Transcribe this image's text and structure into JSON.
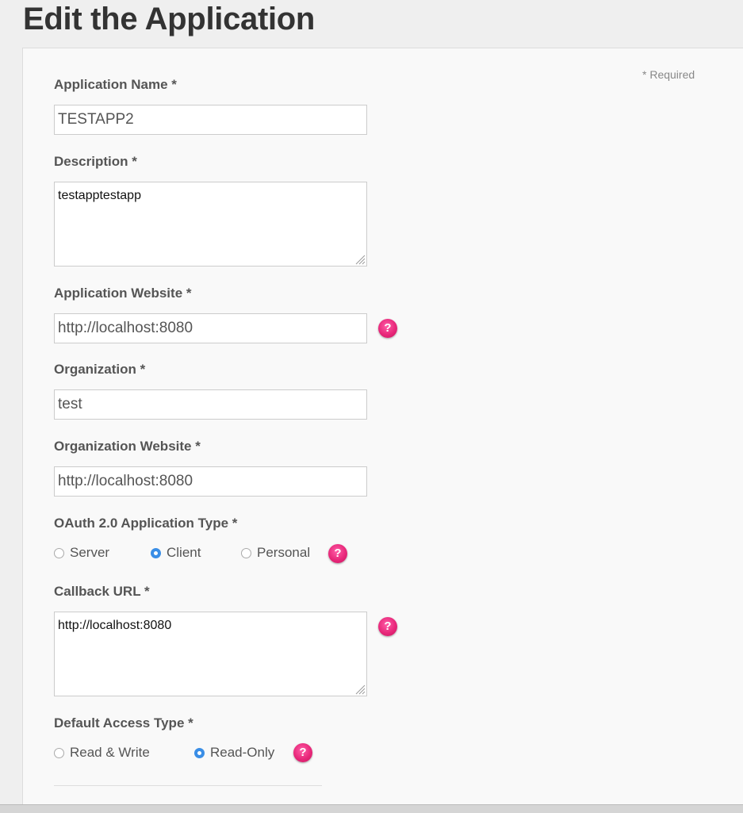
{
  "page": {
    "title": "Edit the Application",
    "required_note": "* Required"
  },
  "form": {
    "app_name": {
      "label": "Application Name *",
      "value": "TESTAPP2"
    },
    "description": {
      "label": "Description *",
      "value": "testapptestapp"
    },
    "app_website": {
      "label": "Application Website *",
      "value": "http://localhost:8080"
    },
    "organization": {
      "label": "Organization *",
      "value": "test"
    },
    "org_website": {
      "label": "Organization Website *",
      "value": "http://localhost:8080"
    },
    "oauth_type": {
      "label": "OAuth 2.0 Application Type *",
      "options": [
        "Server",
        "Client",
        "Personal"
      ],
      "selected": "Client"
    },
    "callback_url": {
      "label": "Callback URL *",
      "value": "http://localhost:8080"
    },
    "access_type": {
      "label": "Default Access Type *",
      "options": [
        "Read & Write",
        "Read-Only"
      ],
      "selected": "Read-Only"
    }
  },
  "help_glyph": "?",
  "icons": {
    "help": "question-mark-icon",
    "resize": "resize-grip-icon",
    "radio": "radio-button-icon"
  },
  "colors": {
    "help_icon": "#e8287a",
    "radio_selected": "#3a8ee6"
  }
}
